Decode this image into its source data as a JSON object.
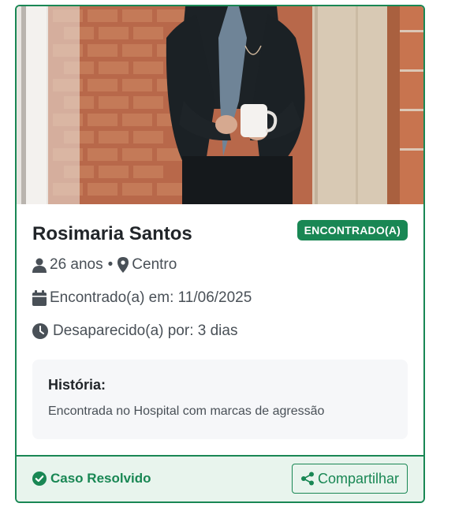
{
  "card": {
    "name": "Rosimaria Santos",
    "status_badge": "ENCONTRADO(A)",
    "age": "26 anos",
    "location": "Centro",
    "found_date": "Encontrado(a) em: 11/06/2025",
    "missing_duration": "Desaparecido(a) por: 3 dias",
    "story": {
      "title": "História:",
      "text": "Encontrada no Hospital com marcas de agressão"
    },
    "footer": {
      "resolved_label": "Caso Resolvido",
      "share_label": "Compartilhar"
    }
  },
  "colors": {
    "accent": "#198754",
    "footer_bg": "#e8f4ed",
    "story_bg": "#f6f7f9"
  },
  "icons": [
    "user-icon",
    "map-pin-icon",
    "calendar-icon",
    "clock-icon",
    "check-circle-icon",
    "share-icon"
  ]
}
